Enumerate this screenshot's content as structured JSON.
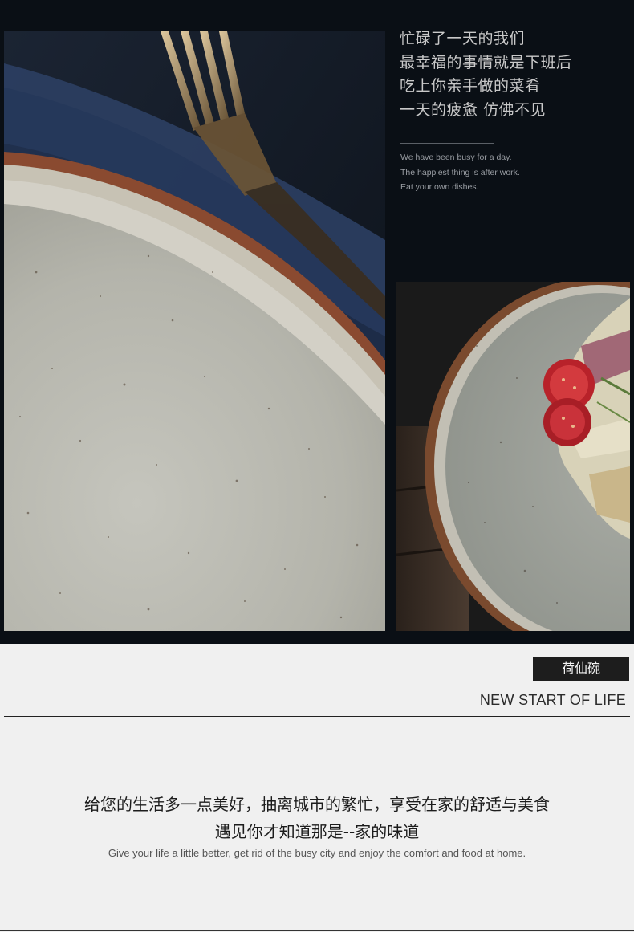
{
  "poem": {
    "lines": [
      "忙碌了一天的我们",
      "最幸福的事情就是下班后",
      "吃上你亲手做的菜肴",
      "一天的疲惫 仿佛不见"
    ]
  },
  "english_poem": {
    "lines": [
      "We have been busy for a day.",
      "The happiest thing is after work.",
      "Eat your own dishes."
    ]
  },
  "tag_label": "荷仙碗",
  "headline": "NEW START OF LIFE",
  "body_cn": [
    "给您的生活多一点美好，抽离城市的繁忙，享受在家的舒适与美食",
    "遇见你才知道那是--家的味道"
  ],
  "body_en": "Give your life a little better, get rid of the busy city and enjoy the comfort and food at home.",
  "colors": {
    "dark_background": "#0a0f15",
    "light_background": "#f0f0f0",
    "plate_glaze": "#b9b9b1",
    "plate_rim": "#8a4a30",
    "fork_gold": "#d8b98a",
    "napkin_blue": "#2c3f63"
  }
}
